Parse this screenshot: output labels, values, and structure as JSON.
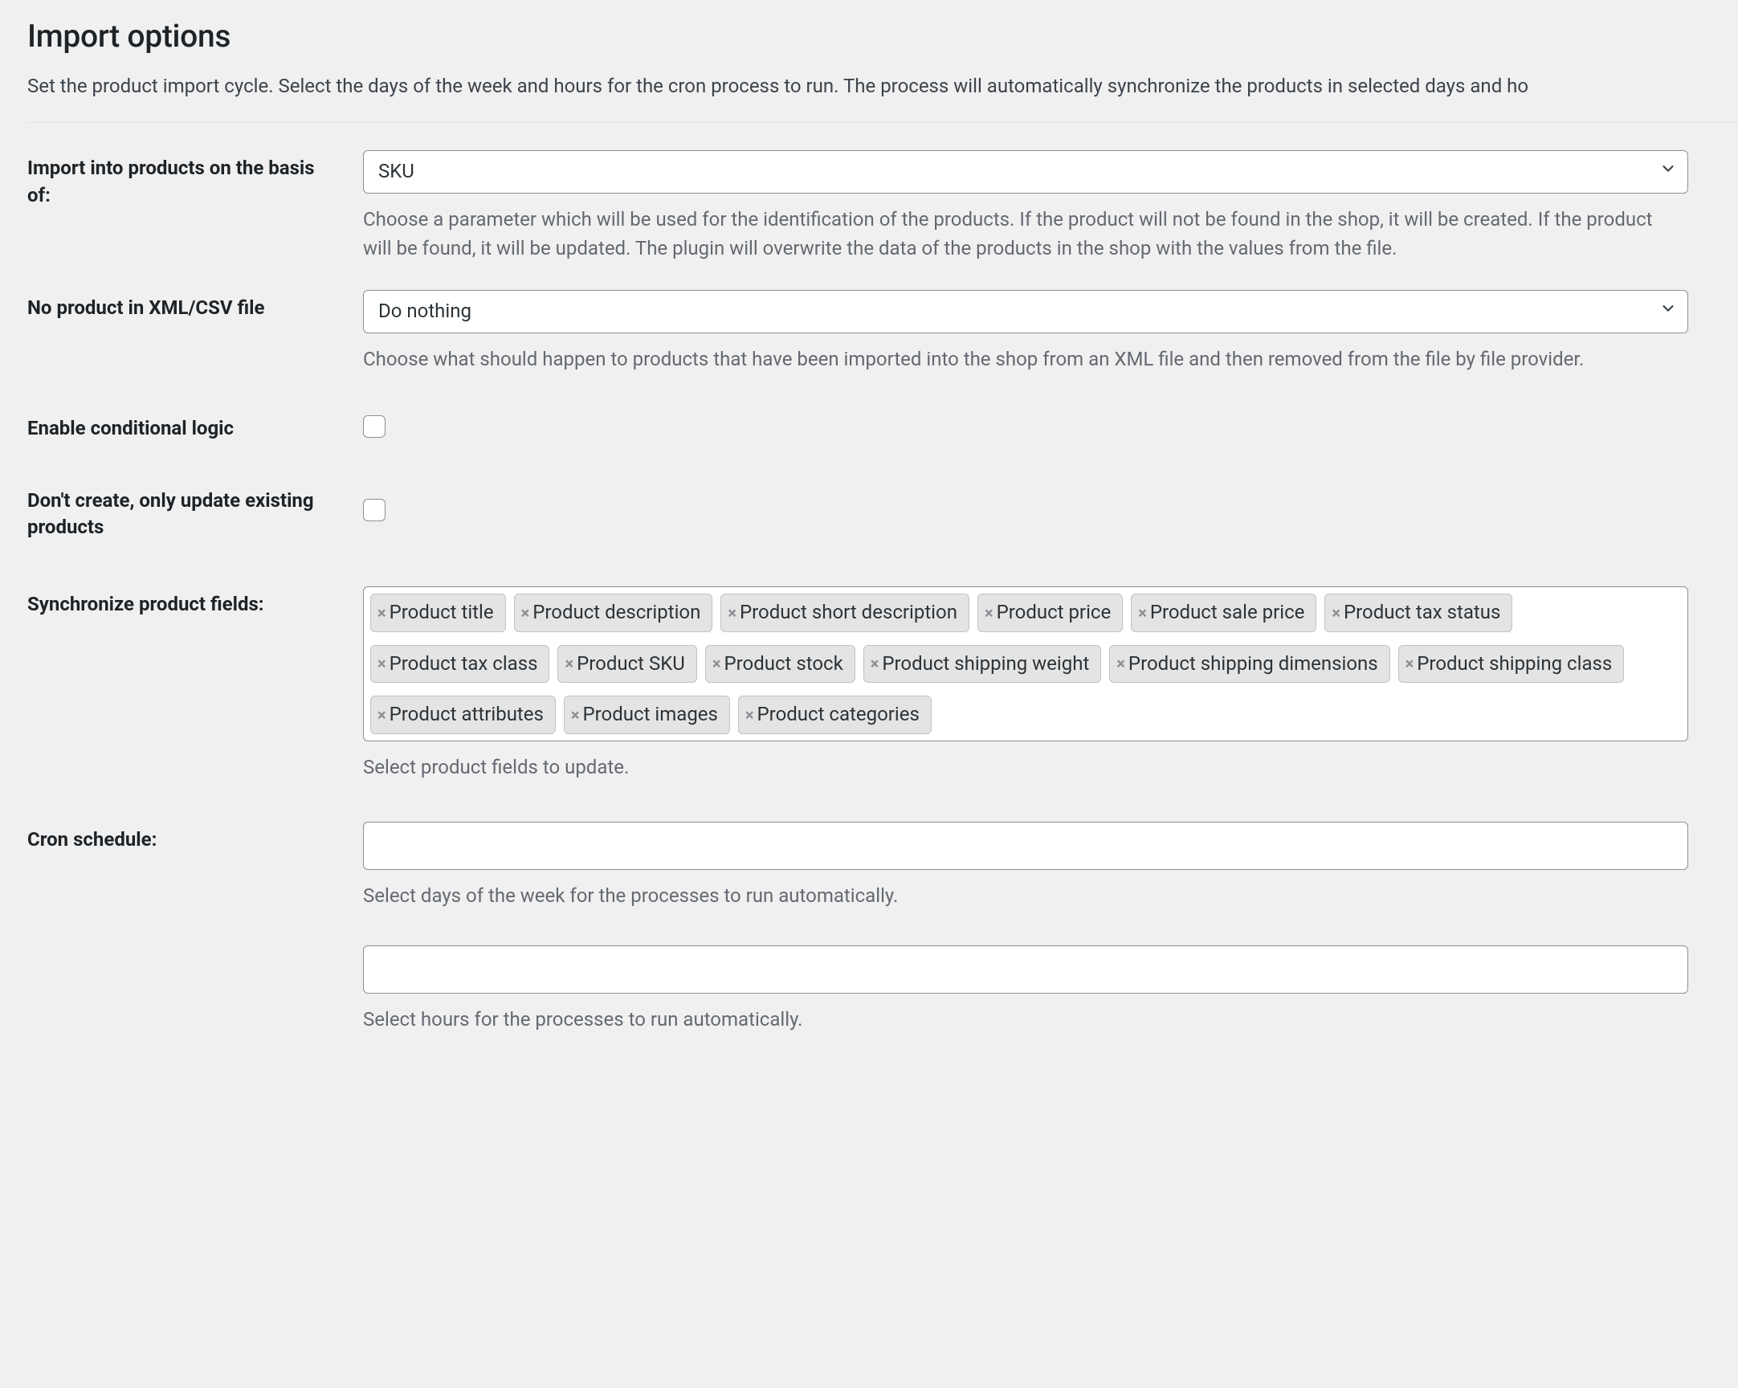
{
  "section": {
    "title": "Import options",
    "intro": "Set the product import cycle. Select the days of the week and hours for the cron process to run. The process will automatically synchronize the products in selected days and ho"
  },
  "fields": {
    "basis": {
      "label": "Import into products on the basis of:",
      "value": "SKU",
      "helper": "Choose a parameter which will be used for the identification of the products. If the product will not be found in the shop, it will be created. If the product will be found, it will be updated. The plugin will overwrite the data of the products in the shop with the values from the file."
    },
    "no_product": {
      "label": "No product in XML/CSV file",
      "value": "Do nothing",
      "helper": "Choose what should happen to products that have been imported into the shop from an XML file and then removed from the file by file provider."
    },
    "conditional_logic": {
      "label": "Enable conditional logic"
    },
    "only_update": {
      "label": "Don't create, only update existing products"
    },
    "sync_fields": {
      "label": "Synchronize product fields:",
      "tags": [
        "Product title",
        "Product description",
        "Product short description",
        "Product price",
        "Product sale price",
        "Product tax status",
        "Product tax class",
        "Product SKU",
        "Product stock",
        "Product shipping weight",
        "Product shipping dimensions",
        "Product shipping class",
        "Product attributes",
        "Product images",
        "Product categories"
      ],
      "helper": "Select product fields to update."
    },
    "cron_days": {
      "label": "Cron schedule:",
      "helper": "Select days of the week for the processes to run automatically."
    },
    "cron_hours": {
      "helper": "Select hours for the processes to run automatically."
    }
  },
  "icons": {
    "tag_close": "×"
  }
}
